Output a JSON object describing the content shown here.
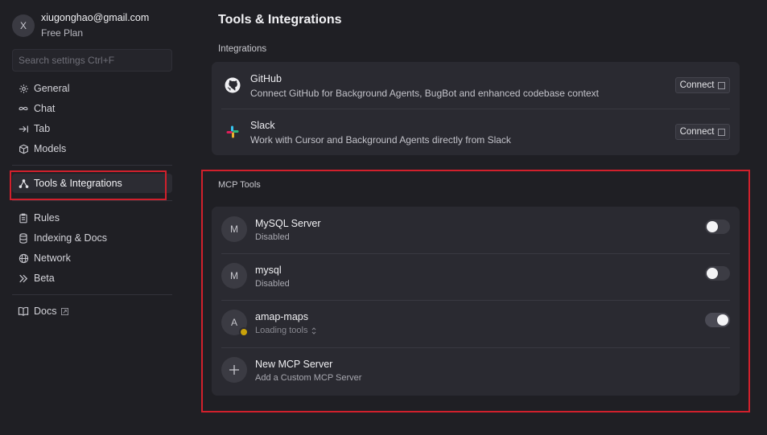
{
  "profile": {
    "avatar_letter": "X",
    "email": "xiugonghao@gmail.com",
    "plan": "Free Plan"
  },
  "search": {
    "placeholder": "Search settings Ctrl+F"
  },
  "sidebar": {
    "items": [
      {
        "label": "General",
        "icon": "gear-icon"
      },
      {
        "label": "Chat",
        "icon": "infinity-icon"
      },
      {
        "label": "Tab",
        "icon": "tab-arrow-icon"
      },
      {
        "label": "Models",
        "icon": "cube-icon"
      },
      {
        "label": "Tools & Integrations",
        "icon": "nodes-icon",
        "active": true
      },
      {
        "label": "Rules",
        "icon": "clipboard-icon"
      },
      {
        "label": "Indexing & Docs",
        "icon": "database-icon"
      },
      {
        "label": "Network",
        "icon": "globe-icon"
      },
      {
        "label": "Beta",
        "icon": "chevrons-right-icon"
      },
      {
        "label": "Docs",
        "icon": "book-icon"
      }
    ]
  },
  "main": {
    "title": "Tools & Integrations",
    "integrations_label": "Integrations",
    "integrations": [
      {
        "name": "GitHub",
        "description": "Connect GitHub for Background Agents, BugBot and enhanced codebase context",
        "button": "Connect",
        "icon": "github-icon"
      },
      {
        "name": "Slack",
        "description": "Work with Cursor and Background Agents directly from Slack",
        "button": "Connect",
        "icon": "slack-icon"
      }
    ],
    "mcp_label": "MCP Tools",
    "mcp_servers": [
      {
        "letter": "M",
        "name": "MySQL Server",
        "status": "Disabled",
        "enabled": false
      },
      {
        "letter": "M",
        "name": "mysql",
        "status": "Disabled",
        "enabled": false
      },
      {
        "letter": "A",
        "name": "amap-maps",
        "status": "Loading tools",
        "enabled": true
      }
    ],
    "new_server": {
      "title": "New MCP Server",
      "subtitle": "Add a Custom MCP Server"
    }
  },
  "colors": {
    "highlight": "#d1202c",
    "status_loading": "#c9a20a"
  }
}
